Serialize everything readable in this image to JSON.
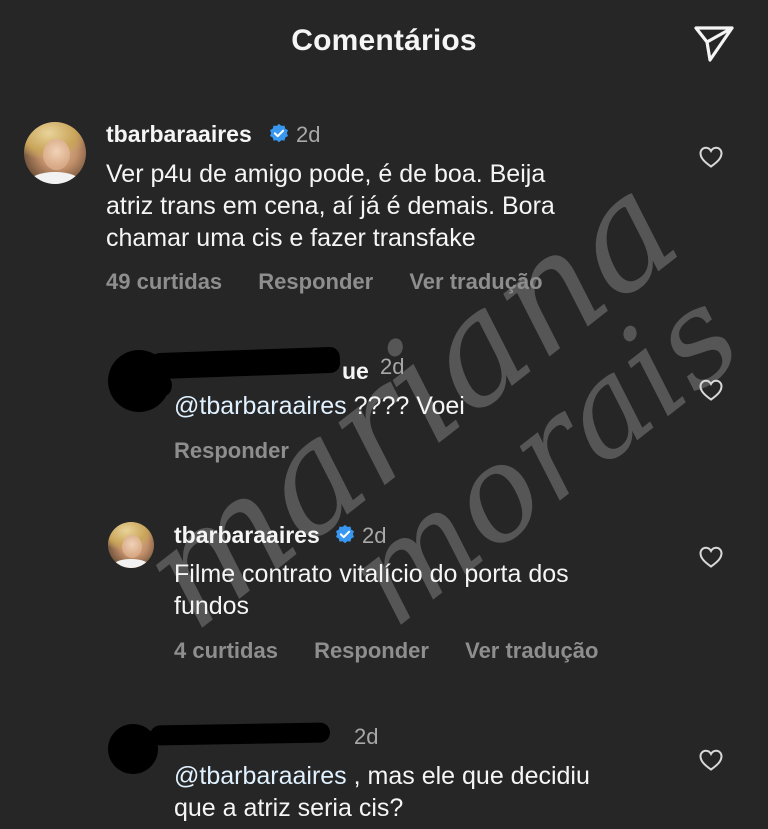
{
  "header": {
    "title": "Comentários",
    "share_icon": "paper-plane-icon"
  },
  "watermark": {
    "text_1": "mariana",
    "text_2": "morais"
  },
  "comments": [
    {
      "username": "tbarbaraaires",
      "verified": true,
      "time": "2d",
      "lines": [
        "Ver p4u de amigo pode, é de boa. Beija",
        "atriz trans em cena, aí já é demais. Bora",
        "chamar uma cis e fazer transfake"
      ],
      "likes": "49 curtidas",
      "reply": "Responder",
      "translate": "Ver tradução"
    },
    {
      "username_partial": "ue",
      "time": "2d",
      "mention": "@tbarbaraaires",
      "text": " ???? Voei",
      "reply": "Responder"
    },
    {
      "username": "tbarbaraaires",
      "verified": true,
      "time": "2d",
      "lines": [
        "Filme contrato vitalício do porta dos",
        "fundos"
      ],
      "likes": "4 curtidas",
      "reply": "Responder",
      "translate": "Ver tradução"
    },
    {
      "time": "2d",
      "mention": "@tbarbaraaires",
      "lines": [
        " , mas ele que decidiu",
        "que a atriz seria cis?"
      ]
    }
  ],
  "colors": {
    "background": "#262626",
    "text": "#f5f5f5",
    "muted": "#8e8e8e",
    "verified": "#3897f0"
  }
}
